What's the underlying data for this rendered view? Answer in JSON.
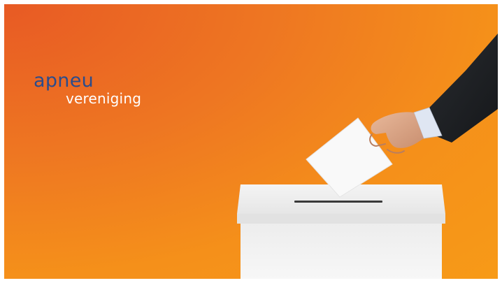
{
  "logo": {
    "line1": "apneu",
    "line2": "vereniging"
  },
  "colors": {
    "background_start": "#e85a24",
    "background_end": "#f79a17",
    "logo_blue": "#2b4c8c",
    "logo_white": "#ffffff",
    "suit": "#1f2226",
    "ballot_box": "#f2f2f2"
  },
  "scene": {
    "objects": [
      "ballot-box",
      "ballot-paper",
      "hand",
      "suit-sleeve",
      "shirt-cuff"
    ]
  }
}
